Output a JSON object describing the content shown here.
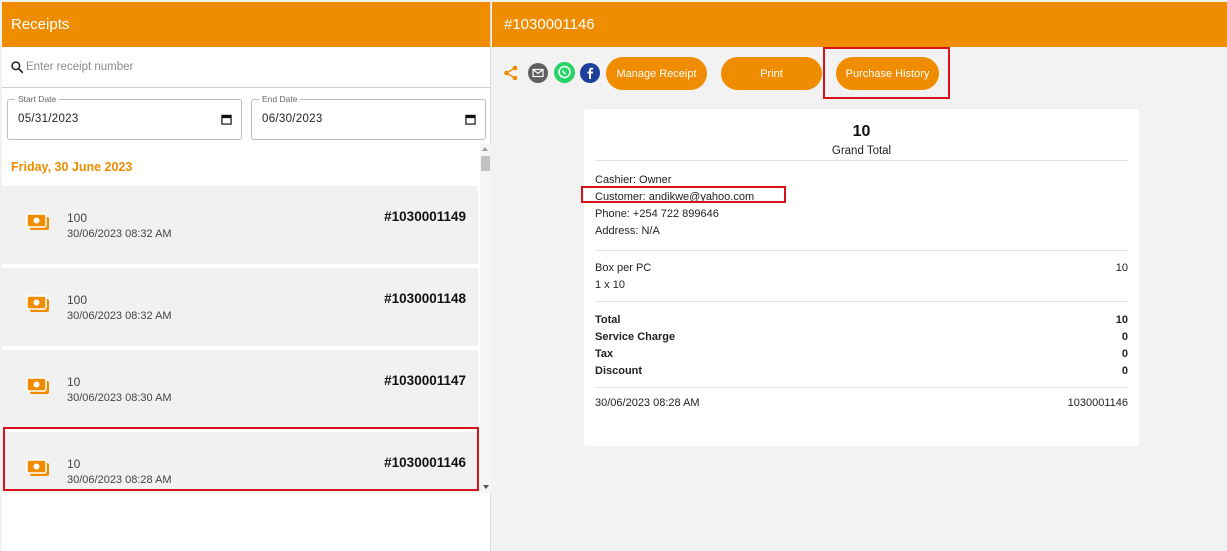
{
  "left_header": {
    "title": "Receipts"
  },
  "search": {
    "placeholder": "Enter receipt number"
  },
  "date_range": {
    "start": {
      "label": "Start Date",
      "value": "05/31/2023"
    },
    "end": {
      "label": "End Date",
      "value": "06/30/2023"
    }
  },
  "day_group": "Friday, 30 June 2023",
  "receipts": [
    {
      "amount": "100",
      "datetime": "30/06/2023 08:32 AM",
      "number": "#1030001149"
    },
    {
      "amount": "100",
      "datetime": "30/06/2023 08:32 AM",
      "number": "#1030001148"
    },
    {
      "amount": "10",
      "datetime": "30/06/2023 08:30 AM",
      "number": "#1030001147"
    },
    {
      "amount": "10",
      "datetime": "30/06/2023 08:28 AM",
      "number": "#1030001146"
    }
  ],
  "detail_header": {
    "title": "#1030001146"
  },
  "share_icons": [
    "share-icon",
    "email-icon",
    "whatsapp-icon",
    "facebook-icon"
  ],
  "actions": {
    "manage": "Manage Receipt",
    "print": "Print",
    "history": "Purchase History"
  },
  "receipt": {
    "grand_total_value": "10",
    "grand_total_label": "Grand Total",
    "cashier": "Cashier: Owner",
    "customer": "Customer: andikwe@yahoo.com",
    "phone": "Phone: +254 722 899646",
    "address": "Address: N/A",
    "item_name": "Box per PC",
    "item_total": "10",
    "item_qty": "1 x 10",
    "totals": [
      {
        "label": "Total",
        "value": "10"
      },
      {
        "label": "Service Charge",
        "value": "0"
      },
      {
        "label": "Tax",
        "value": "0"
      },
      {
        "label": "Discount",
        "value": "0"
      }
    ],
    "footer_date": "30/06/2023 08:28 AM",
    "footer_number": "1030001146"
  },
  "colors": {
    "accent": "#ef8c00",
    "highlight": "#d7121b",
    "panel": "#f1f1f1"
  }
}
